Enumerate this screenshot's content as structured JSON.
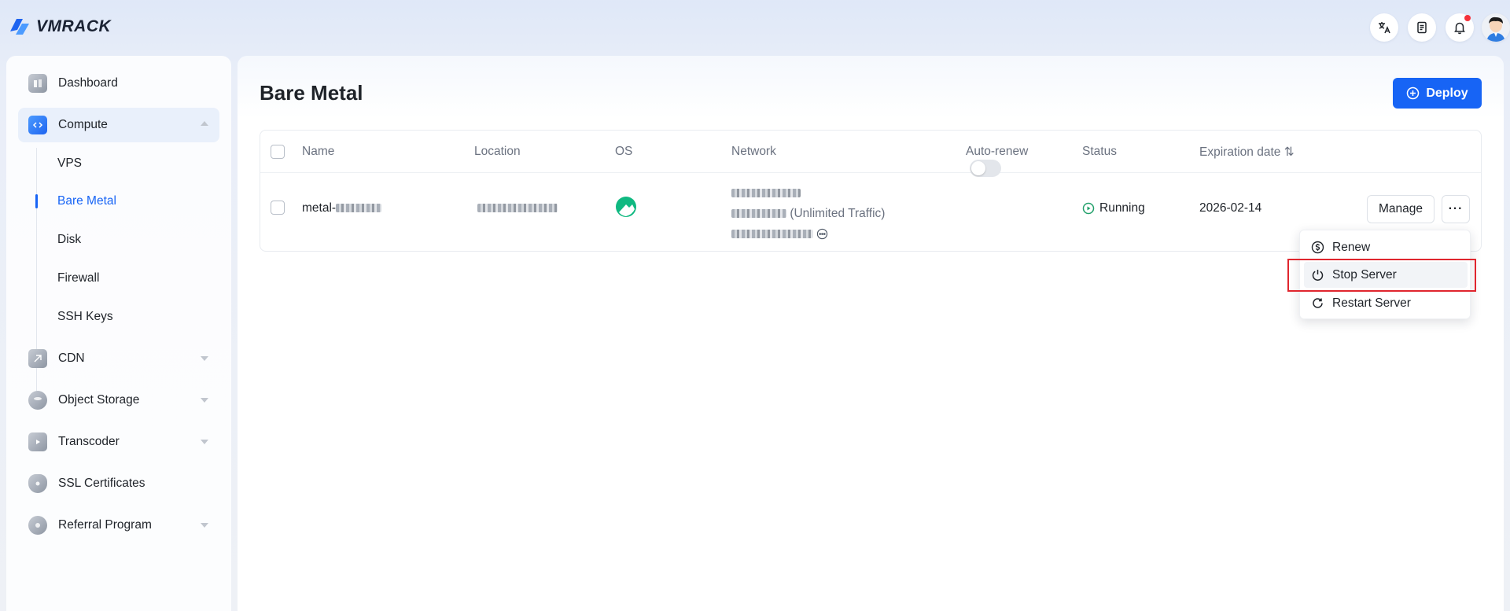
{
  "app": {
    "brand": "VMRACK"
  },
  "topbar": {
    "icons": [
      "translate-icon",
      "document-icon",
      "bell-icon",
      "avatar"
    ],
    "has_notification": true
  },
  "sidebar": {
    "items": [
      {
        "label": "Dashboard",
        "icon": "dashboard-icon"
      },
      {
        "label": "Compute",
        "icon": "compute-icon",
        "expanded": true,
        "children": [
          {
            "label": "VPS"
          },
          {
            "label": "Bare Metal",
            "active": true
          },
          {
            "label": "Disk"
          },
          {
            "label": "Firewall"
          },
          {
            "label": "SSH Keys"
          }
        ]
      },
      {
        "label": "CDN",
        "icon": "cdn-icon"
      },
      {
        "label": "Object Storage",
        "icon": "storage-icon"
      },
      {
        "label": "Transcoder",
        "icon": "transcoder-icon"
      },
      {
        "label": "SSL Certificates",
        "icon": "shield-icon"
      },
      {
        "label": "Referral Program",
        "icon": "referral-icon"
      }
    ]
  },
  "main": {
    "title": "Bare Metal",
    "deploy_label": "Deploy",
    "table": {
      "columns": [
        "Name",
        "Location",
        "OS",
        "Network",
        "Auto-renew",
        "Status",
        "Expiration date ⇅"
      ],
      "rows": [
        {
          "name_prefix": "metal-",
          "network_traffic": "(Unlimited Traffic)",
          "auto_renew": false,
          "status": "Running",
          "expiration": "2026-02-14",
          "manage_label": "Manage",
          "more_label": "···"
        }
      ]
    },
    "menu": {
      "items": [
        {
          "label": "Renew",
          "icon": "renew-icon"
        },
        {
          "label": "Stop Server",
          "icon": "power-icon",
          "highlighted": true
        },
        {
          "label": "Restart Server",
          "icon": "restart-icon"
        }
      ]
    }
  },
  "colors": {
    "accent": "#1764f5",
    "running": "#22a06b",
    "highlight": "#e0262e"
  }
}
